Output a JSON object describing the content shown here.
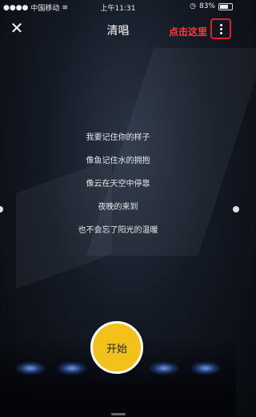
{
  "status_bar": {
    "carrier": "中国移动",
    "time": "上午11:31",
    "battery": "83%"
  },
  "header": {
    "title": "清唱",
    "tip": "点击这里"
  },
  "lyrics": [
    "我要记住你的样子",
    "像鱼记住水的拥抱",
    "像云在天空中停靠",
    "夜晚的来到",
    "也不会忘了阳光的温暖"
  ],
  "start_button": {
    "label": "开始"
  },
  "colors": {
    "accent_yellow": "#f2c21b",
    "tip_red": "#ff3b3b",
    "highlight_border": "#e02020"
  }
}
